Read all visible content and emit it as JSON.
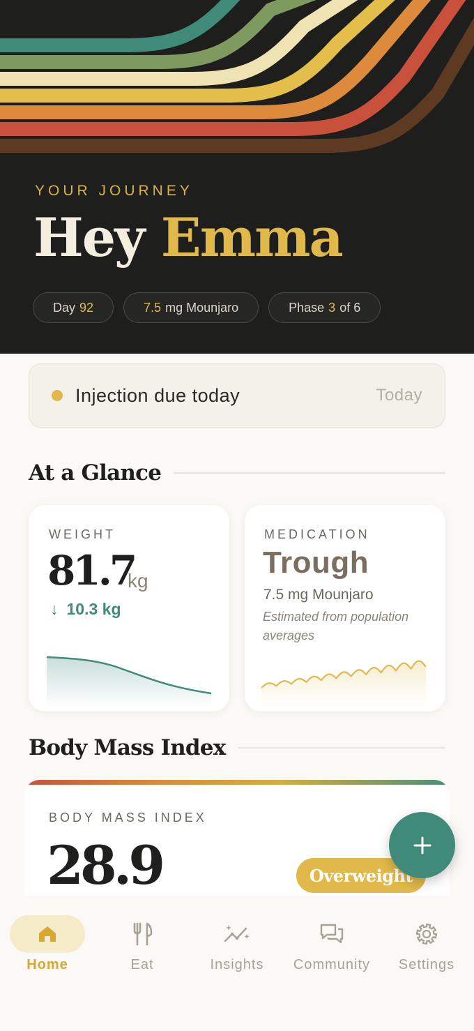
{
  "colors": {
    "background": "#faf9f6",
    "hero": "#1e1e1c",
    "accent_gold": "#e0b94a",
    "accent_teal": "#3f8a79",
    "stripes": [
      "#3f8a79",
      "#7f9a5e",
      "#f0e3b3",
      "#e3be4b",
      "#dd8a3c",
      "#c9503b",
      "#5e3a22"
    ]
  },
  "hero": {
    "eyebrow": "YOUR JOURNEY",
    "greeting": "Hey",
    "name": "Emma",
    "pills": [
      {
        "prefix": "Day",
        "value": "92",
        "suffix": ""
      },
      {
        "prefix": "",
        "value": "7.5",
        "suffix": "mg Mounjaro"
      },
      {
        "prefix": "Phase",
        "value": "3",
        "suffix": "of 6"
      }
    ]
  },
  "alert": {
    "title": "Injection due today",
    "when": "Today"
  },
  "glance": {
    "title": "At a Glance",
    "weight": {
      "label": "WEIGHT",
      "value": "81.7",
      "unit": "kg",
      "delta_arrow": "↓",
      "delta": "10.3 kg"
    },
    "medication": {
      "label": "MEDICATION",
      "status": "Trough",
      "dose": "7.5 mg Mounjaro",
      "note": "Estimated from population averages"
    }
  },
  "bmi": {
    "section_title": "Body Mass Index",
    "label": "BODY MASS INDEX",
    "value": "28.9",
    "category": "Overweight"
  },
  "fab": {
    "icon": "plus-icon"
  },
  "tabs": [
    {
      "label": "Home",
      "icon": "home-icon",
      "active": true
    },
    {
      "label": "Eat",
      "icon": "fork-knife-icon",
      "active": false
    },
    {
      "label": "Insights",
      "icon": "sparkle-chart-icon",
      "active": false
    },
    {
      "label": "Community",
      "icon": "chat-bubbles-icon",
      "active": false
    },
    {
      "label": "Settings",
      "icon": "gear-icon",
      "active": false
    }
  ]
}
